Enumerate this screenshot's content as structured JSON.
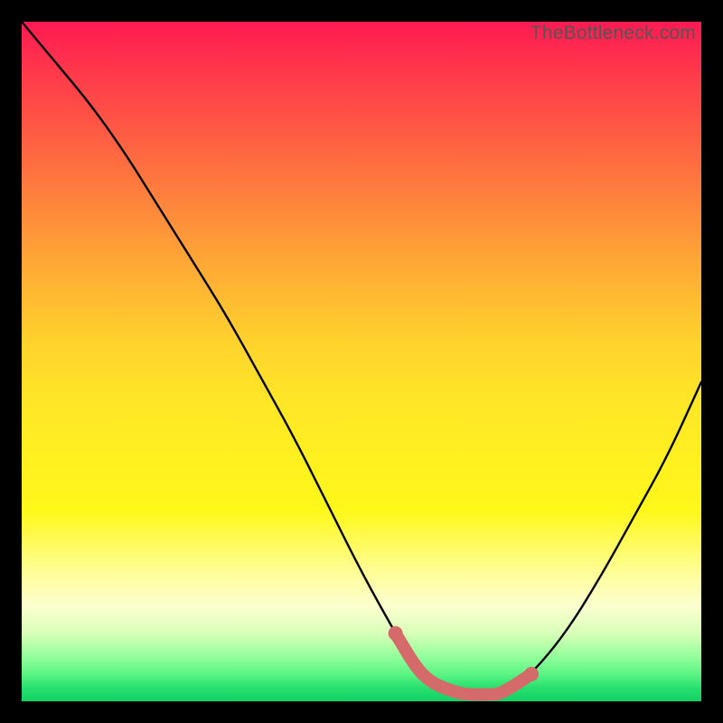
{
  "watermark": "TheBottleneck.com",
  "chart_data": {
    "type": "line",
    "title": "",
    "xlabel": "",
    "ylabel": "",
    "xlim": [
      0,
      100
    ],
    "ylim": [
      0,
      100
    ],
    "grid": false,
    "legend": false,
    "series": [
      {
        "name": "bottleneck-curve",
        "color": "#000000",
        "x": [
          0,
          5,
          10,
          15,
          20,
          25,
          30,
          35,
          40,
          45,
          50,
          55,
          58,
          60,
          62,
          65,
          68,
          70,
          72,
          75,
          80,
          85,
          90,
          95,
          100
        ],
        "values": [
          100,
          94,
          88,
          81,
          73,
          65,
          57,
          48,
          39,
          29,
          19,
          10,
          5,
          3,
          2,
          1,
          1,
          1,
          2,
          4,
          10,
          18,
          27,
          36,
          47
        ]
      },
      {
        "name": "optimal-range-highlight",
        "color": "#d46a6a",
        "x": [
          55,
          58,
          60,
          62,
          65,
          68,
          70,
          72,
          75
        ],
        "values": [
          10,
          5,
          3,
          2,
          1,
          1,
          1,
          2,
          4
        ]
      }
    ],
    "colors": {
      "background_top": "#ff1a52",
      "background_bottom": "#12d066",
      "frame": "#000000",
      "curve": "#000000",
      "highlight": "#d46a6a",
      "watermark": "#555555"
    }
  }
}
